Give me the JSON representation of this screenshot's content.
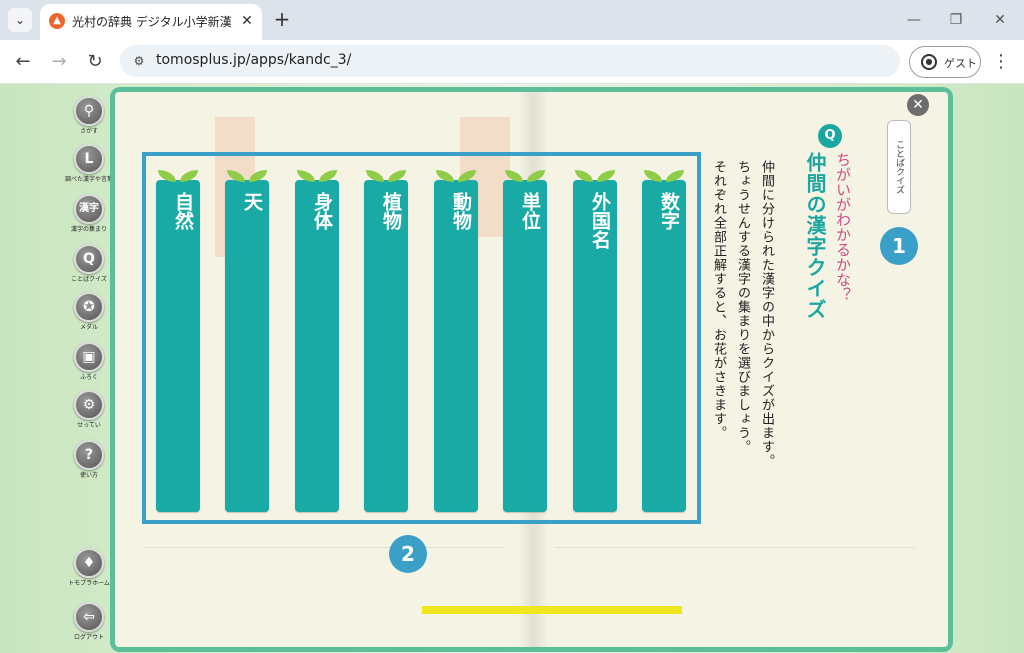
{
  "browser": {
    "tab_title": "光村の辞典 デジタル小学新漢字辞典",
    "tab_favicon": "fire-icon",
    "new_tab": "+",
    "url": "tomosplus.jp/apps/kandc_3/",
    "profile_label": "ゲスト",
    "window_controls": [
      "minimize-icon",
      "restore-icon",
      "close-icon"
    ]
  },
  "sidebar": {
    "items": [
      {
        "label": "さがす",
        "icon": "search-icon"
      },
      {
        "label": "調べた漢字や言葉",
        "icon": "history-icon"
      },
      {
        "label": "漢字の集まり",
        "icon": "kanji-group-icon",
        "glyph": "漢字"
      },
      {
        "label": "ことばクイズ",
        "icon": "quiz-icon",
        "glyph": "Q"
      },
      {
        "label": "メダル",
        "icon": "medal-icon"
      },
      {
        "label": "ふろく",
        "icon": "gift-icon"
      },
      {
        "label": "せってい",
        "icon": "gear-icon"
      },
      {
        "label": "使い方",
        "icon": "help-icon",
        "glyph": "?"
      },
      {
        "label": "トモプラホーム",
        "icon": "home-icon"
      },
      {
        "label": "ログアウト",
        "icon": "logout-icon"
      }
    ]
  },
  "quiz": {
    "type_label": "ことばクイズ",
    "marker1": "1",
    "marker2": "2",
    "q_badge": "Q",
    "hint": "ちがいがわかるかな？",
    "title": "仲間の漢字クイズ",
    "body_lines": [
      "仲間に分けられた漢字の中からクイズが出ます。",
      "ちょうせんする漢字の集まりを選びましょう。",
      "それぞれ全部正解すると、お花がさきます。"
    ],
    "categories": [
      "数字",
      "外国名",
      "単位",
      "動物",
      "植物",
      "身体",
      "天",
      "自然"
    ]
  },
  "colors": {
    "accent": "#1aa7a0",
    "frame": "#5dbf9a",
    "highlight": "#3aa0c8",
    "hint": "#d14d87",
    "leaf": "#8fcd49",
    "progress": "#f0e61e"
  }
}
